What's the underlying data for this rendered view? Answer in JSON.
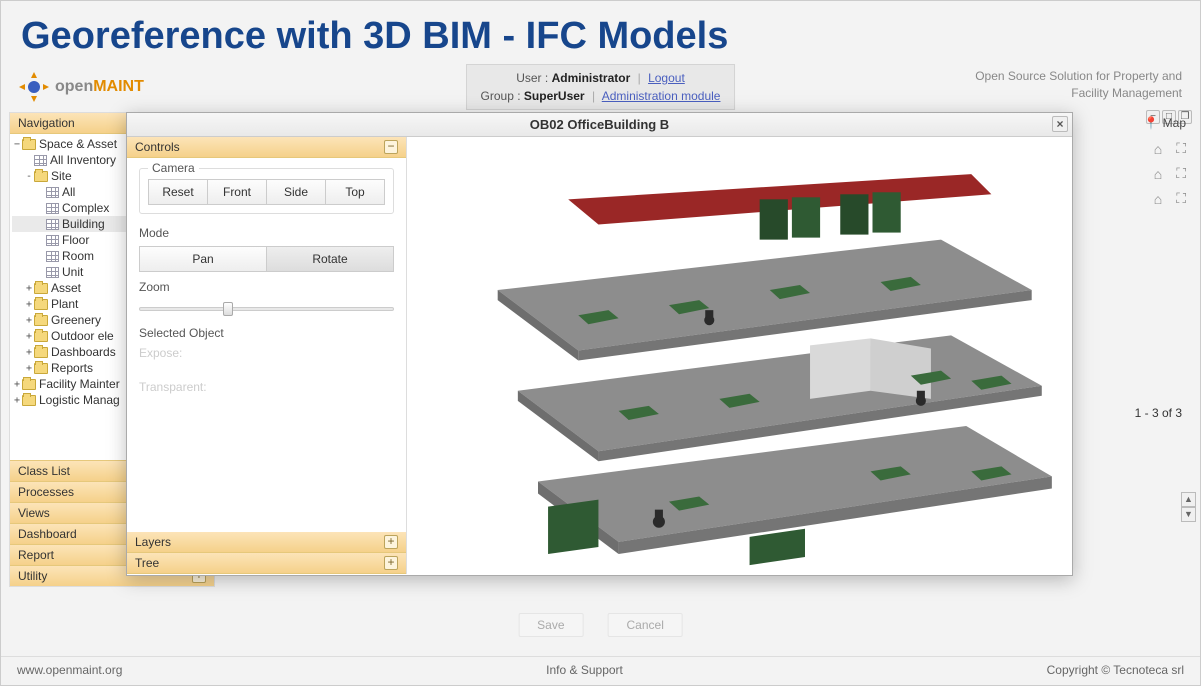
{
  "page_title": "Georeference with 3D BIM - IFC Models",
  "brand": {
    "name": "openMAINT"
  },
  "tagline_l1": "Open Source Solution for Property and",
  "tagline_l2": "Facility Management",
  "user_info": {
    "user_label": "User :",
    "user_value": "Administrator",
    "logout": "Logout",
    "group_label": "Group :",
    "group_value": "SuperUser",
    "admin_link": "Administration module"
  },
  "nav": {
    "header": "Navigation",
    "root": "Space & Asset",
    "items": [
      {
        "label": "All Inventory",
        "icon": "grid",
        "indent": 1
      },
      {
        "label": "Site",
        "icon": "folder",
        "indent": 1,
        "exp": "-"
      },
      {
        "label": "All",
        "icon": "grid",
        "indent": 2
      },
      {
        "label": "Complex",
        "icon": "grid",
        "indent": 2
      },
      {
        "label": "Building",
        "icon": "grid",
        "indent": 2,
        "selected": true
      },
      {
        "label": "Floor",
        "icon": "grid",
        "indent": 2
      },
      {
        "label": "Room",
        "icon": "grid",
        "indent": 2
      },
      {
        "label": "Unit",
        "icon": "grid",
        "indent": 2
      },
      {
        "label": "Asset",
        "icon": "folder",
        "indent": 1,
        "exp": "+"
      },
      {
        "label": "Plant",
        "icon": "folder",
        "indent": 1,
        "exp": "+"
      },
      {
        "label": "Greenery",
        "icon": "folder",
        "indent": 1,
        "exp": "+"
      },
      {
        "label": "Outdoor ele",
        "icon": "folder",
        "indent": 1,
        "exp": "+"
      },
      {
        "label": "Dashboards",
        "icon": "folder",
        "indent": 1,
        "exp": "+"
      },
      {
        "label": "Reports",
        "icon": "folder",
        "indent": 1,
        "exp": "+"
      }
    ],
    "extra_roots": [
      "Facility Mainter",
      "Logistic Manag"
    ],
    "accordion": [
      "Class List",
      "Processes",
      "Views",
      "Dashboard",
      "Report",
      "Utility"
    ]
  },
  "modal": {
    "title": "OB02 OfficeBuilding B",
    "controls_header": "Controls",
    "camera": {
      "legend": "Camera",
      "buttons": [
        "Reset",
        "Front",
        "Side",
        "Top"
      ]
    },
    "mode": {
      "label": "Mode",
      "options": [
        "Pan",
        "Rotate"
      ],
      "active": "Rotate"
    },
    "zoom_label": "Zoom",
    "selected_object": {
      "label": "Selected Object",
      "expose": "Expose:",
      "transparent": "Transparent:"
    },
    "footer_panels": [
      "Layers",
      "Tree"
    ]
  },
  "list": {
    "map_label": "Map",
    "pager": "1 - 3 of 3"
  },
  "actions": {
    "save": "Save",
    "cancel": "Cancel"
  },
  "footer": {
    "left": "www.openmaint.org",
    "center": "Info & Support",
    "right": "Copyright © Tecnoteca srl"
  }
}
